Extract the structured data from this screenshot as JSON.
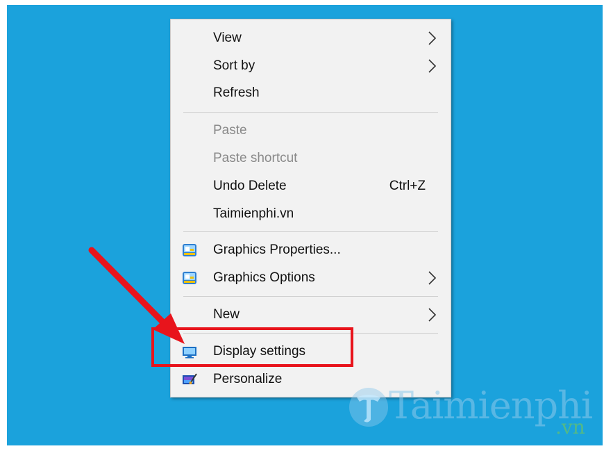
{
  "menu": {
    "items": [
      {
        "label": "View",
        "submenu": true,
        "enabled": true
      },
      {
        "label": "Sort by",
        "submenu": true,
        "enabled": true
      },
      {
        "label": "Refresh",
        "enabled": true
      },
      {
        "label": "Paste",
        "enabled": false
      },
      {
        "label": "Paste shortcut",
        "enabled": false
      },
      {
        "label": "Undo Delete",
        "shortcut": "Ctrl+Z",
        "enabled": true
      },
      {
        "label": "Taimienphi.vn",
        "enabled": true
      },
      {
        "label": "Graphics Properties...",
        "icon": "intel-graphics-icon",
        "enabled": true
      },
      {
        "label": "Graphics Options",
        "icon": "intel-graphics-icon",
        "submenu": true,
        "enabled": true
      },
      {
        "label": "New",
        "submenu": true,
        "enabled": true
      },
      {
        "label": "Display settings",
        "icon": "display-settings-icon",
        "enabled": true,
        "highlighted": true
      },
      {
        "label": "Personalize",
        "icon": "personalize-icon",
        "enabled": true
      }
    ]
  },
  "annotation": {
    "arrow_color": "#e8141c",
    "box_color": "#e8141c"
  },
  "watermark": {
    "brand": "Taimienphi",
    "domain": ".vn"
  },
  "colors": {
    "desktop": "#1ba2dc",
    "menu_bg": "#f2f2f2",
    "disabled_text": "#8a8a8a"
  }
}
